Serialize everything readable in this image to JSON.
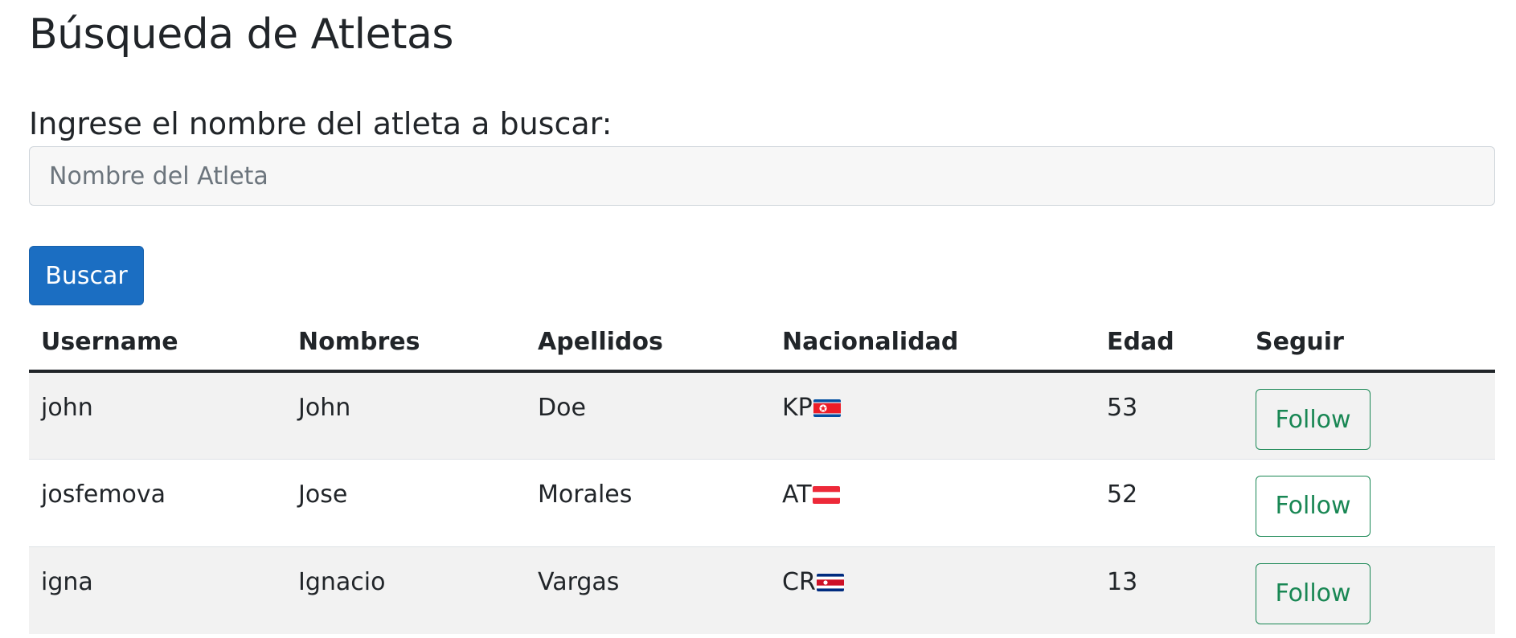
{
  "page": {
    "title": "Búsqueda de Atletas"
  },
  "search": {
    "label": "Ingrese el nombre del atleta a buscar:",
    "placeholder": "Nombre del Atleta",
    "value": "",
    "button_label": "Buscar"
  },
  "table": {
    "headers": [
      "Username",
      "Nombres",
      "Apellidos",
      "Nacionalidad",
      "Edad",
      "Seguir"
    ],
    "rows": [
      {
        "username": "john",
        "nombres": "John",
        "apellidos": "Doe",
        "nacionalidad": "KP",
        "flag_icon": "flag-north-korea-icon",
        "edad": "53",
        "follow_label": "Follow"
      },
      {
        "username": "josfemova",
        "nombres": "Jose",
        "apellidos": "Morales",
        "nacionalidad": "AT",
        "flag_icon": "flag-austria-icon",
        "edad": "52",
        "follow_label": "Follow"
      },
      {
        "username": "igna",
        "nombres": "Ignacio",
        "apellidos": "Vargas",
        "nacionalidad": "CR",
        "flag_icon": "flag-costa-rica-icon",
        "edad": "13",
        "follow_label": "Follow"
      }
    ]
  },
  "colors": {
    "primary": "#1b6ec2",
    "success": "#198754",
    "text": "#212529",
    "stripe": "#f2f2f2"
  }
}
